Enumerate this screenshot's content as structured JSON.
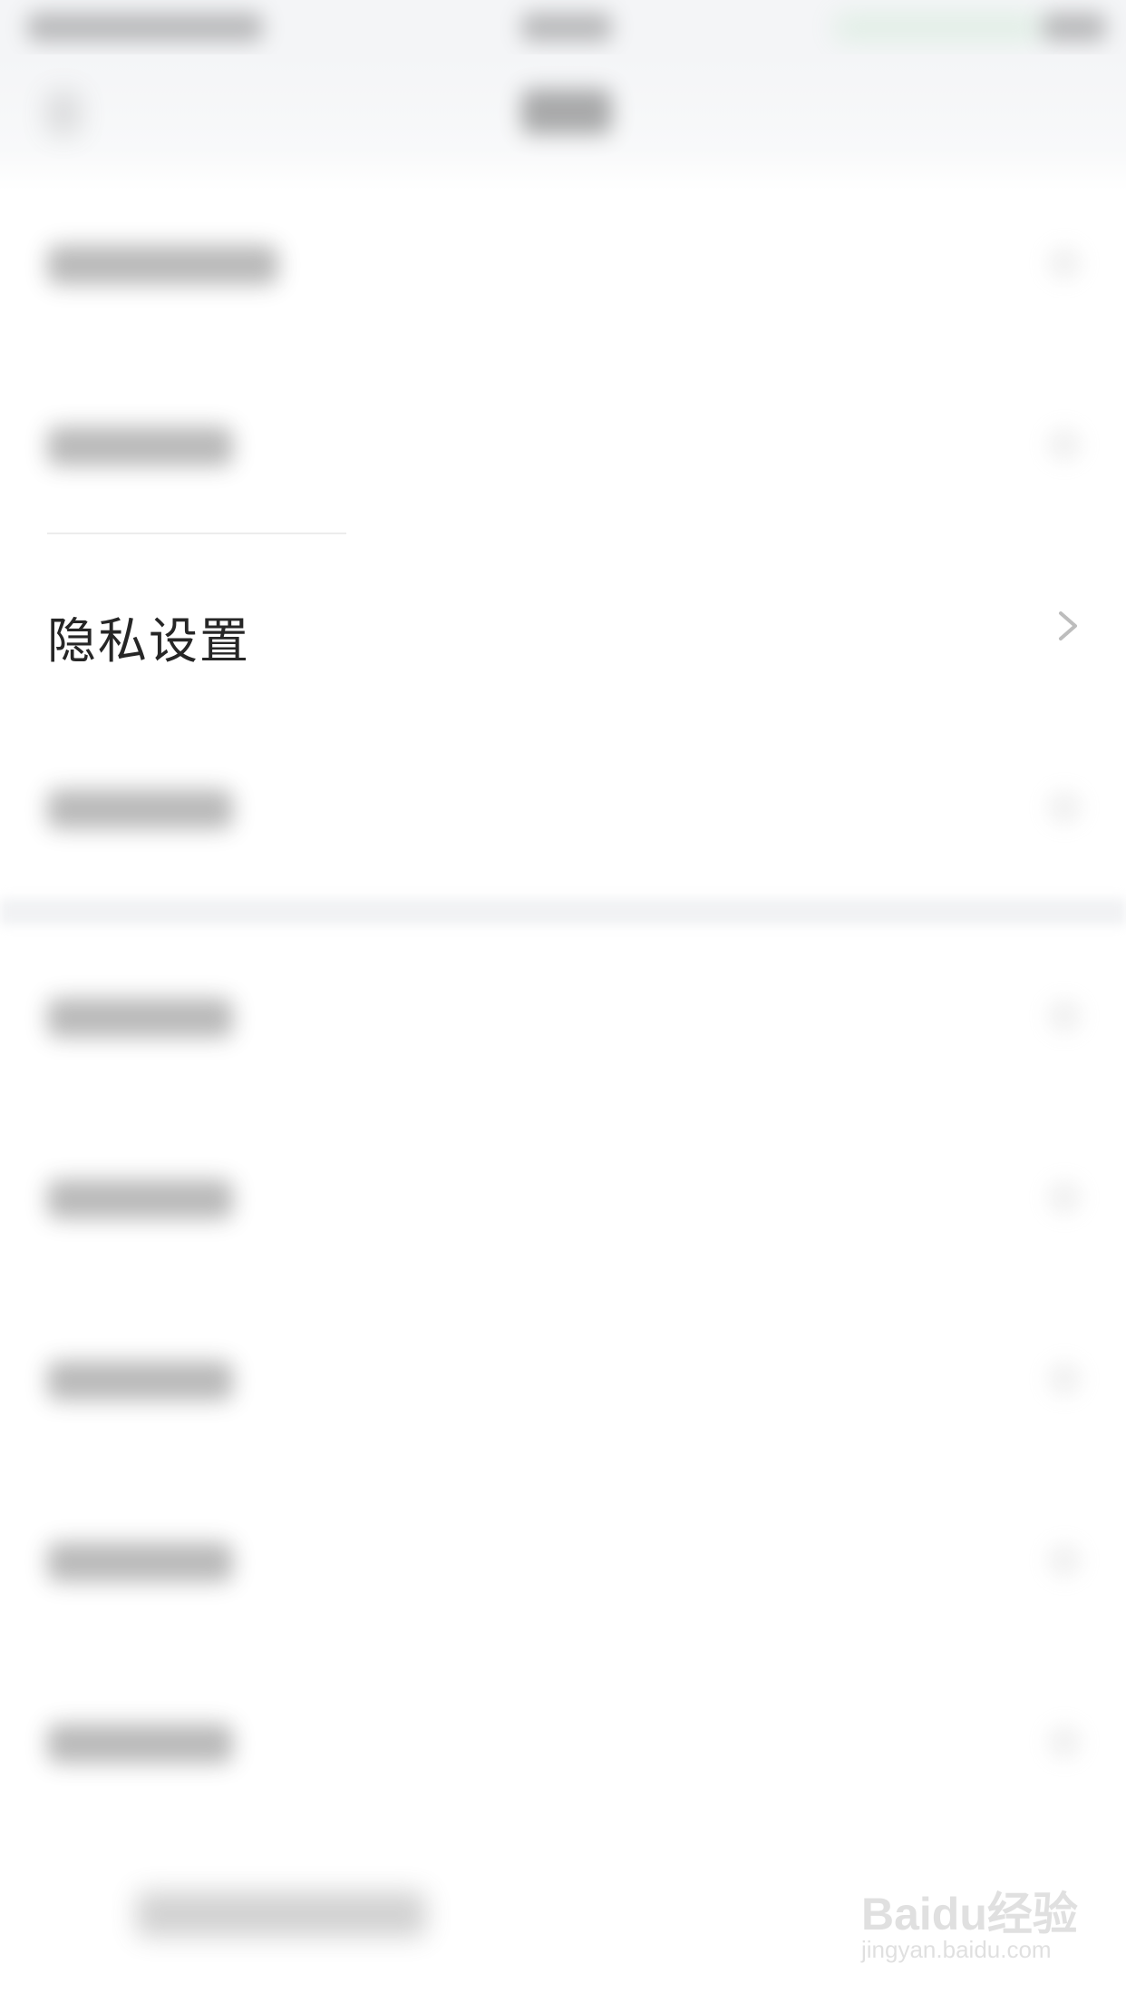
{
  "privacy_row": {
    "label": "隐私设置"
  },
  "watermark": {
    "brand": "Baidu经验",
    "url": "jingyan.baidu.com"
  },
  "icons": {
    "chevron": "chevron-right-icon",
    "back": "back-arrow-icon"
  },
  "colors": {
    "background": "#ffffff",
    "nav_background": "#f4f5f7",
    "label_text": "#262626",
    "chevron": "#bdbdbd",
    "watermark": "#a9a9a9"
  }
}
